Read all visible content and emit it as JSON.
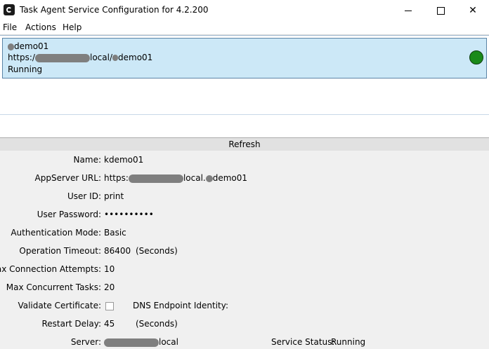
{
  "window": {
    "title": "Task Agent Service Configuration for 4.2.200",
    "minimize": "—",
    "maximize": "□",
    "close": "✕"
  },
  "menu": {
    "file": "File",
    "actions": "Actions",
    "help": "Help"
  },
  "list": {
    "item": {
      "name": "demo01",
      "url_prefix": "https:/",
      "url_middle": "local/",
      "url_suffix": "demo01",
      "status": "Running",
      "status_color": "#1a8a1a"
    }
  },
  "refresh_label": "Refresh",
  "details": {
    "name_label": "Name:",
    "name_value": "kdemo01",
    "url_label": "AppServer URL:",
    "url_prefix": "https:",
    "url_middle": "local.",
    "url_suffix": "demo01",
    "userid_label": "User ID:",
    "userid_value": "print",
    "password_label": "User Password:",
    "password_value": "••••••••••",
    "auth_label": "Authentication Mode:",
    "auth_value": "Basic",
    "timeout_label": "Operation Timeout:",
    "timeout_value": "86400",
    "timeout_unit": "(Seconds)",
    "max_conn_label": "Max Connection Attempts:",
    "max_conn_value": "10",
    "max_tasks_label": "Max Concurrent Tasks:",
    "max_tasks_value": "20",
    "validate_label": "Validate Certificate:",
    "dns_label": "DNS Endpoint Identity:",
    "restart_label": "Restart Delay:",
    "restart_value": "45",
    "restart_unit": "(Seconds)",
    "server_label": "Server:",
    "server_suffix": "local",
    "service_status_label": "Service Status:",
    "service_status_value": "Running"
  }
}
